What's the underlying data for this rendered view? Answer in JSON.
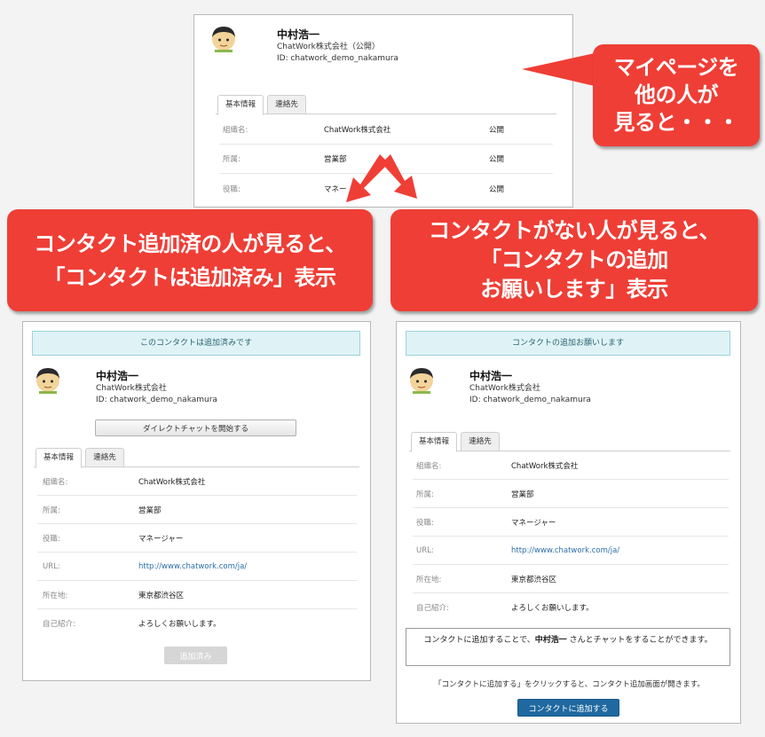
{
  "profile": {
    "name": "中村浩一",
    "org_public": "ChatWork株式会社（公開）",
    "org": "ChatWork株式会社",
    "id_line": "ID: chatwork_demo_nakamura"
  },
  "tabs": {
    "basic": "基本情報",
    "contact": "連絡先"
  },
  "top_rows": [
    {
      "label": "組織名:",
      "value": "ChatWork株式会社",
      "vis": "公開"
    },
    {
      "label": "所属:",
      "value": "営業部",
      "vis": "公開"
    },
    {
      "label": "役職:",
      "value": "マネー",
      "vis": "公開"
    }
  ],
  "detail_rows": [
    {
      "label": "組織名:",
      "value": "ChatWork株式会社"
    },
    {
      "label": "所属:",
      "value": "営業部"
    },
    {
      "label": "役職:",
      "value": "マネージャー"
    },
    {
      "label": "URL:",
      "value": "http://www.chatwork.com/ja/"
    },
    {
      "label": "所在地:",
      "value": "東京都渋谷区"
    },
    {
      "label": "自己紹介:",
      "value": "よろしくお願いします。"
    }
  ],
  "bubbles": {
    "top": [
      "マイページを",
      "他の人が",
      "見ると・・・"
    ],
    "left": [
      "コンタクト追加済の人が見ると、",
      "「コンタクトは追加済み」表示"
    ],
    "right": [
      "コンタクトがない人が見ると、",
      "「コンタクトの追加",
      "お願いします」表示"
    ]
  },
  "left_panel": {
    "banner": "このコンタクトは追加済みです",
    "direct_chat_button": "ダイレクトチャットを開始する",
    "added_button": "追加済み"
  },
  "right_panel": {
    "banner": "コンタクトの追加お願いします",
    "note_prefix": "コンタクトに追加することで、",
    "note_name": "中村浩一",
    "note_suffix": " さんとチャットをすることができます。",
    "hint": "「コンタクトに追加する」をクリックすると、コンタクト追加画面が開きます。",
    "add_button": "コンタクトに追加する"
  },
  "colors": {
    "bubble_red": "#ef3e36",
    "banner_bg": "#dff3f6",
    "link_blue": "#2a6ea8",
    "button_blue": "#1f68a0"
  }
}
